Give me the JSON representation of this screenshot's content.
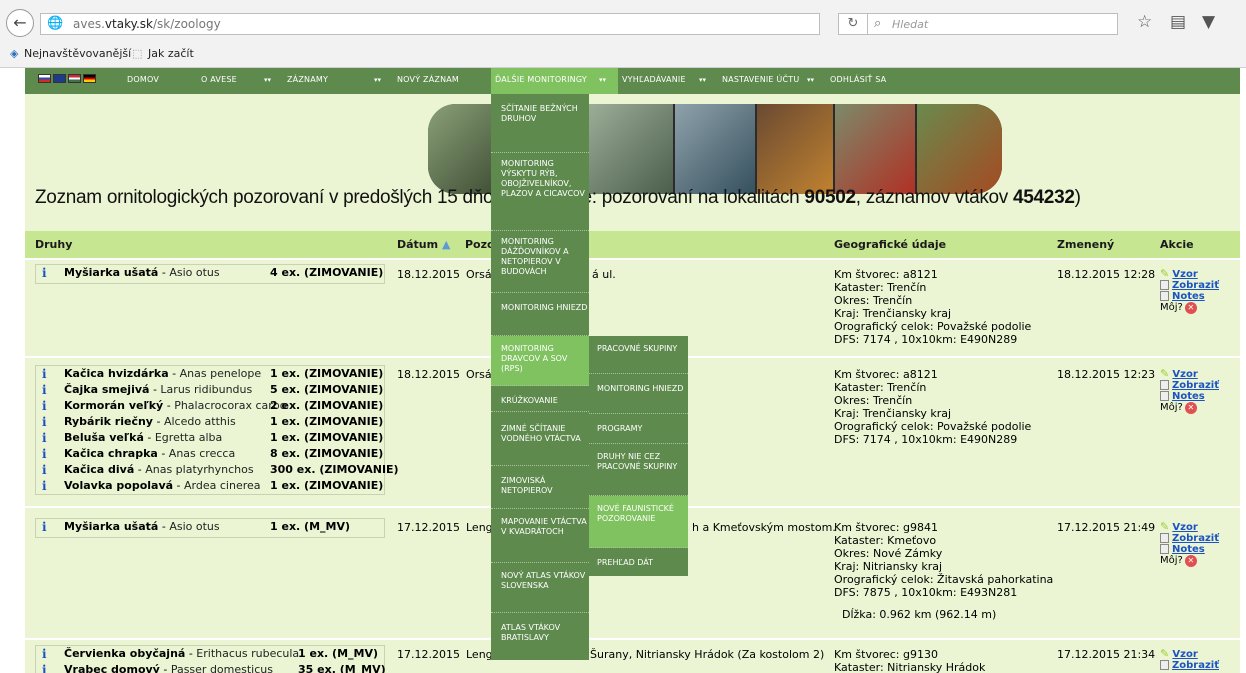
{
  "browser": {
    "url_host": "aves.",
    "url_domain": "vtaky.sk",
    "url_path": "/sk/zoology",
    "search_placeholder": "Hledat",
    "back_glyph": "←",
    "bookmarks": [
      "Nejnavštěvovanější",
      "Jak začít"
    ]
  },
  "nav": {
    "items": [
      "DOMOV",
      "O AVESE",
      "ZÁZNAMY",
      "NOVÝ ZÁZNAM",
      "ĎALŠIE MONITORINGY",
      "VYHĽADÁVANIE",
      "NASTAVENIE ÚČTU",
      "ODHLÁSIŤ SA"
    ],
    "colors": {
      "bar": "#5e8a4e",
      "active": "#7fc25f",
      "page_bg": "#ebf5d3",
      "header_bg": "#c7e692",
      "link": "#1b52c4"
    }
  },
  "heading": {
    "pre": "Zoznam ornitologických pozorovaní v predošlých 15 dňo",
    "mid": "bsahuje: pozorovaní na lokalitách ",
    "n1": "90502",
    "mid2": ", záznamov vtákov ",
    "n2": "454232",
    "end": ")"
  },
  "table": {
    "headers": [
      "Druhy",
      "Dátum",
      "Pozo",
      "Geografické údaje",
      "Zmenený",
      "Akcie"
    ],
    "rows": [
      {
        "species": [
          {
            "sk": "Myšiarka ušatá",
            "lat": "Asio otus",
            "count": "4 ex. (ZIMOVANIE)"
          }
        ],
        "date": "18.12.2015",
        "place": "Orsá",
        "place2": "á ul.",
        "geo": [
          "Km štvorec: a8121",
          "Kataster: Trenčín",
          "Okres: Trenčín",
          "Kraj: Trenčiansky kraj",
          "Orografický celok: Považské podolie",
          "DFS: 7174 , 10x10km: E490N289"
        ],
        "changed": "18.12.2015 12:28"
      },
      {
        "species": [
          {
            "sk": "Kačica hvizdárka",
            "lat": "Anas penelope",
            "count": "1 ex. (ZIMOVANIE)"
          },
          {
            "sk": "Čajka smejivá",
            "lat": "Larus ridibundus",
            "count": "5 ex. (ZIMOVANIE)"
          },
          {
            "sk": "Kormorán veľký",
            "lat": "Phalacrocorax carbo",
            "count": "2 ex. (ZIMOVANIE)"
          },
          {
            "sk": "Rybárik riečny",
            "lat": "Alcedo atthis",
            "count": "1 ex. (ZIMOVANIE)"
          },
          {
            "sk": "Beluša veľká",
            "lat": "Egretta alba",
            "count": "1 ex. (ZIMOVANIE)"
          },
          {
            "sk": "Kačica chrapka",
            "lat": "Anas crecca",
            "count": "8 ex. (ZIMOVANIE)"
          },
          {
            "sk": "Kačica divá",
            "lat": "Anas platyrhynchos",
            "count": "300 ex. (ZIMOVANIE)"
          },
          {
            "sk": "Volavka popolavá",
            "lat": "Ardea cinerea",
            "count": "1 ex. (ZIMOVANIE)"
          }
        ],
        "date": "18.12.2015",
        "place": "Orsá",
        "place2": "",
        "geo": [
          "Km štvorec: a8121",
          "Kataster: Trenčín",
          "Okres: Trenčín",
          "Kraj: Trenčiansky kraj",
          "Orografický celok: Považské podolie",
          "DFS: 7174 , 10x10km: E490N289"
        ],
        "changed": "18.12.2015 12:23"
      },
      {
        "species": [
          {
            "sk": "Myšiarka ušatá",
            "lat": "Asio otus",
            "count": "1 ex. (M_MV)"
          }
        ],
        "date": "17.12.2015",
        "place": "Leng",
        "place2": "h a Kmeťovským mostom.",
        "geo": [
          "Km štvorec: g9841",
          "Kataster: Kmeťovo",
          "Okres: Nové Zámky",
          "Kraj: Nitriansky kraj",
          "Orografický celok: Žitavská pahorkatina",
          "DFS: 7875 , 10x10km: E493N281"
        ],
        "length": "Dĺžka: 0.962 km (962.14 m)",
        "changed": "17.12.2015 21:49"
      },
      {
        "species": [
          {
            "sk": "Červienka obyčajná",
            "lat": "Erithacus rubecula",
            "count": "1 ex. (M_MV)"
          },
          {
            "sk": "Vrabec domový",
            "lat": "Passer domesticus",
            "count": "35 ex. (M_MV)"
          }
        ],
        "date": "17.12.2015",
        "place": "Lengyel Józef",
        "place2": "Šurany, Nitriansky Hrádok (Za kostolom 2)",
        "geo": [
          "Km štvorec: g9130",
          "Kataster: Nitriansky Hrádok"
        ],
        "changed": "17.12.2015 21:34"
      }
    ],
    "actions": {
      "vzor": "Vzor",
      "zobrazit": "Zobraziť",
      "notes": "Notes",
      "moj": "Môj?"
    }
  },
  "dropdown": {
    "items": [
      "SČÍTANIE BEŽNÝCH DRUHOV",
      "MONITORING VÝSKYTU RÝB, OBOJŽIVELNÍKOV, PLAZOV A CICAVCOV",
      "MONITORING DÁŽĎOVNÍKOV A NETOPIEROV V BUDOVÁCH",
      "MONITORING HNIEZD",
      "MONITORING DRAVCOV A SOV (RPS)",
      "KRÚŽKOVANIE",
      "ZIMNÉ SČÍTANIE VODNÉHO VTÁCTVA",
      "ZIMOVISKÁ NETOPIEROV",
      "MAPOVANIE VTÁCTVA V KVADRÁTOCH",
      "NOVÝ ATLAS VTÁKOV SLOVENSKA",
      "ATLAS VTÁKOV BRATISLAVY"
    ],
    "submenu": [
      "PRACOVNÉ SKUPINY",
      "MONITORING HNIEZD",
      "PROGRAMY",
      "DRUHY NIE CEZ PRACOVNÉ SKUPINY",
      "NOVÉ FAUNISTICKÉ POZOROVANIE",
      "PREHĽAD DÁT"
    ]
  }
}
